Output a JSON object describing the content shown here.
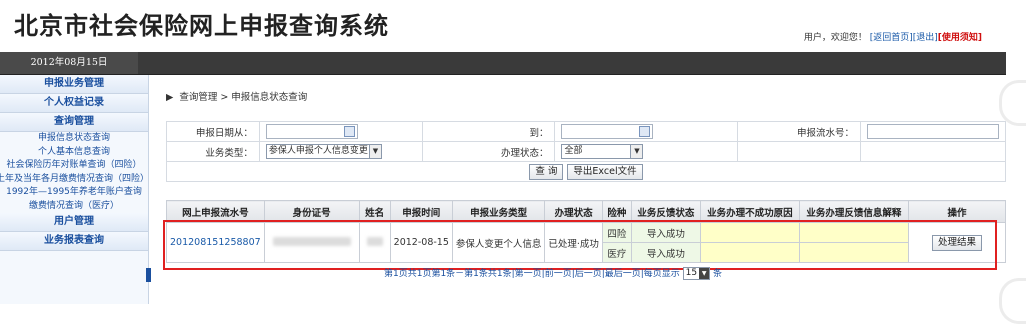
{
  "header": {
    "title": "北京市社会保险网上申报查询系统",
    "user_prefix": "用户，欢迎您！",
    "links": [
      "[返回首页]",
      "[退出]",
      "[使用须知]"
    ],
    "date": "2012年08月15日"
  },
  "sidebar": {
    "sections": [
      {
        "label": "申报业务管理"
      },
      {
        "label": "个人权益记录"
      },
      {
        "label": "查询管理"
      }
    ],
    "query_items": [
      "申报信息状态查询",
      "个人基本信息查询",
      "社会保险历年对账单查询（四险）",
      "上年及当年各月缴费情况查询（四险）",
      "1992年—1995年养老年账户查询",
      "缴费情况查询（医疗）"
    ],
    "bottom_sections": [
      "用户管理",
      "业务报表查询"
    ]
  },
  "breadcrumb": "查询管理 > 申报信息状态查询",
  "filters": {
    "date_from_label": "申报日期从：",
    "date_to_label": "到：",
    "serial_label": "申报流水号：",
    "biz_type_label": "业务类型：",
    "biz_type_value": "参保人申报个人信息变更",
    "status_label": "办理状态：",
    "status_value": "全部",
    "query_button": "查 询",
    "export_button": "导出Excel文件"
  },
  "table": {
    "columns": [
      "网上申报流水号",
      "身份证号",
      "姓名",
      "申报时间",
      "申报业务类型",
      "办理状态",
      "险种",
      "业务反馈状态",
      "业务办理不成功原因",
      "业务办理反馈信息解释",
      "操作"
    ],
    "row": {
      "serial": "201208151258807",
      "date": "2012-08-15",
      "biz_type": "参保人变更个人信息",
      "status": "已处理·成功",
      "insurance": [
        "四险",
        "医疗"
      ],
      "feedback": [
        "导入成功",
        "导入成功"
      ],
      "action": "处理结果"
    }
  },
  "pager": {
    "text": "第1页共1页第1条－第1条共1条|第一页|前一页|后一页|最后一页|每页显示",
    "page_size": "15",
    "suffix": "条"
  }
}
